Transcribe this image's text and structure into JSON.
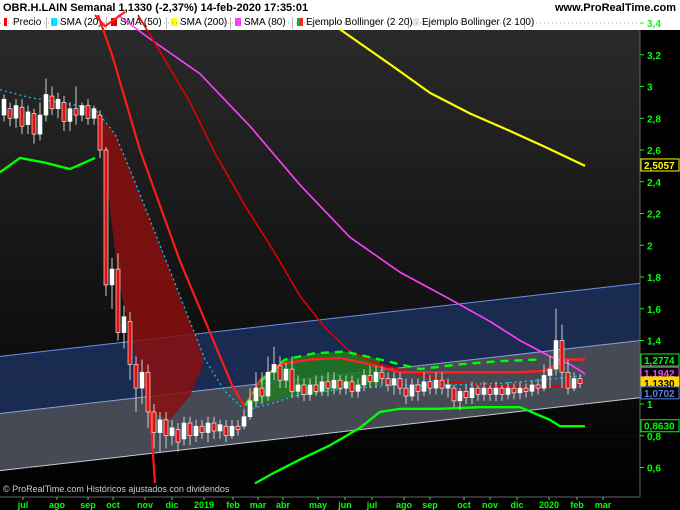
{
  "header": {
    "title": "OBR.H.LAIN Semanal 1,1330 (-2,37%) 14-feb-2020 17:35:01",
    "site": "www.ProRealTime.com"
  },
  "legend": [
    {
      "label": "Precio",
      "color": "#ff0000",
      "color2": "#ffffff"
    },
    {
      "label": "SMA (20)",
      "color": "#00e5ff"
    },
    {
      "label": "SMA (50)",
      "color": "#e00000"
    },
    {
      "label": "SMA (200)",
      "color": "#ffff00"
    },
    {
      "label": "SMA (80)",
      "color": "#ff40ff"
    },
    {
      "label": "Ejemplo Bollinger (2 20)",
      "color": "#00c000",
      "color2": "#ff2020"
    },
    {
      "label": "Ejemplo Bollinger (2 100)",
      "color": "#dde6f0"
    }
  ],
  "footer": {
    "copyright": "© ProRealTime.com  Históricos ajustados con dividendos"
  },
  "chart_data": {
    "type": "candlestick",
    "y_ticks": [
      "3,4",
      "3,2",
      "3",
      "2,8",
      "2,6",
      "2,4",
      "2,2",
      "2",
      "1,8",
      "1,6",
      "1,4",
      "1,2",
      "1",
      "0,8",
      "0,6"
    ],
    "x_ticks": [
      "jul",
      "ago",
      "sep",
      "oct",
      "nov",
      "dic",
      "2019",
      "feb",
      "mar",
      "abr",
      "may",
      "jun",
      "jul",
      "ago",
      "sep",
      "oct",
      "nov",
      "dic",
      "2020",
      "feb",
      "mar"
    ],
    "ylim": [
      0.5,
      3.45
    ],
    "price_tags": [
      {
        "label": "2,5057",
        "value": 2.5057,
        "color": "#ffff00"
      },
      {
        "label": "1,2774",
        "value": 1.2774,
        "color": "#00ff00"
      },
      {
        "label": "1,1942",
        "value": 1.1942,
        "color": "#ff40ff"
      },
      {
        "label": "1,1330",
        "value": 1.133,
        "color": "#ffd700"
      },
      {
        "label": "1,0702",
        "value": 1.0702,
        "color": "#5a7fe0"
      },
      {
        "label": "0,8630",
        "value": 0.863,
        "color": "#00ff00"
      }
    ],
    "series": [
      {
        "name": "SMA (200)",
        "points": [
          [
            340,
            3.36
          ],
          [
            390,
            3.14
          ],
          [
            430,
            2.96
          ],
          [
            470,
            2.83
          ],
          [
            510,
            2.72
          ],
          [
            545,
            2.62
          ],
          [
            585,
            2.5
          ]
        ]
      },
      {
        "name": "SMA (80)",
        "points": [
          [
            118,
            3.45
          ],
          [
            150,
            3.3
          ],
          [
            200,
            3.08
          ],
          [
            250,
            2.75
          ],
          [
            300,
            2.38
          ],
          [
            350,
            2.05
          ],
          [
            400,
            1.83
          ],
          [
            450,
            1.66
          ],
          [
            490,
            1.52
          ],
          [
            520,
            1.4
          ],
          [
            550,
            1.3
          ],
          [
            570,
            1.25
          ],
          [
            585,
            1.19
          ]
        ]
      },
      {
        "name": "SMA (50)",
        "points": [
          [
            138,
            3.45
          ],
          [
            160,
            3.22
          ],
          [
            190,
            2.9
          ],
          [
            215,
            2.58
          ],
          [
            245,
            2.25
          ],
          [
            275,
            1.95
          ],
          [
            300,
            1.68
          ],
          [
            325,
            1.48
          ],
          [
            350,
            1.33
          ],
          [
            380,
            1.25
          ],
          [
            410,
            1.2
          ],
          [
            450,
            1.14
          ],
          [
            500,
            1.11
          ],
          [
            540,
            1.1
          ],
          [
            575,
            1.12
          ],
          [
            585,
            1.15
          ]
        ]
      },
      {
        "name": "SMA (20)",
        "points": [
          [
            0,
            2.98
          ],
          [
            30,
            2.93
          ],
          [
            60,
            2.9
          ],
          [
            95,
            2.86
          ],
          [
            115,
            2.7
          ],
          [
            135,
            2.4
          ],
          [
            160,
            2.0
          ],
          [
            185,
            1.6
          ],
          [
            205,
            1.28
          ],
          [
            225,
            1.08
          ],
          [
            245,
            0.96
          ],
          [
            270,
            1.0
          ],
          [
            300,
            1.06
          ],
          [
            350,
            1.1
          ],
          [
            400,
            1.12
          ],
          [
            450,
            1.12
          ],
          [
            500,
            1.13
          ],
          [
            540,
            1.15
          ],
          [
            585,
            1.18
          ]
        ]
      },
      {
        "name": "Ejemplo Bollinger (2 20) upper",
        "points": [
          [
            95,
            3.45
          ],
          [
            105,
            3.38
          ],
          [
            125,
            3.47
          ]
        ]
      },
      {
        "name": "Ejemplo Bollinger (2 20) lower",
        "points": [
          [
            0,
            2.46
          ],
          [
            20,
            2.55
          ],
          [
            45,
            2.52
          ],
          [
            70,
            2.48
          ],
          [
            95,
            2.55
          ]
        ]
      },
      {
        "name": "Ejemplo Bollinger (2 20) basis",
        "points": [
          [
            245,
            0.99
          ],
          [
            260,
            1.15
          ],
          [
            280,
            1.25
          ],
          [
            310,
            1.28
          ],
          [
            340,
            1.29
          ],
          [
            370,
            1.25
          ],
          [
            400,
            1.2
          ],
          [
            440,
            1.2
          ],
          [
            480,
            1.2
          ],
          [
            520,
            1.2
          ],
          [
            545,
            1.21
          ],
          [
            565,
            1.28
          ],
          [
            585,
            1.28
          ]
        ]
      },
      {
        "name": "Ejemplo Bollinger (2 20) upper green",
        "points": [
          [
            245,
            0.99
          ],
          [
            262,
            1.15
          ],
          [
            285,
            1.28
          ],
          [
            315,
            1.32
          ],
          [
            345,
            1.33
          ],
          [
            380,
            1.28
          ],
          [
            420,
            1.22
          ],
          [
            460,
            1.25
          ],
          [
            500,
            1.27
          ],
          [
            540,
            1.28
          ]
        ]
      },
      {
        "name": "Ejemplo Bollinger (2 20) lower green",
        "points": [
          [
            255,
            0.5
          ],
          [
            275,
            0.57
          ],
          [
            300,
            0.65
          ],
          [
            330,
            0.74
          ],
          [
            360,
            0.85
          ],
          [
            380,
            0.95
          ],
          [
            400,
            0.97
          ],
          [
            440,
            0.97
          ],
          [
            480,
            0.98
          ],
          [
            520,
            0.98
          ],
          [
            550,
            0.9
          ],
          [
            560,
            0.86
          ],
          [
            585,
            0.86
          ]
        ]
      }
    ],
    "bollinger_100": {
      "upper": [
        [
          0,
          1.3
        ],
        [
          640,
          1.76
        ]
      ],
      "lower": [
        [
          0,
          0.58
        ],
        [
          640,
          1.04
        ]
      ],
      "mid": [
        [
          0,
          0.94
        ],
        [
          640,
          1.4
        ]
      ]
    },
    "candles": [
      [
        4,
        2.82,
        2.92,
        2.78,
        2.95
      ],
      [
        10,
        2.86,
        2.8,
        2.75,
        2.9
      ],
      [
        16,
        2.8,
        2.88,
        2.74,
        2.92
      ],
      [
        22,
        2.87,
        2.75,
        2.7,
        2.92
      ],
      [
        28,
        2.76,
        2.84,
        2.7,
        2.88
      ],
      [
        34,
        2.83,
        2.7,
        2.64,
        2.86
      ],
      [
        40,
        2.7,
        2.82,
        2.66,
        2.9
      ],
      [
        46,
        2.82,
        2.95,
        2.78,
        3.05
      ],
      [
        52,
        2.94,
        2.86,
        2.82,
        3.0
      ],
      [
        58,
        2.86,
        2.92,
        2.8,
        2.96
      ],
      [
        64,
        2.9,
        2.78,
        2.72,
        2.94
      ],
      [
        70,
        2.78,
        2.86,
        2.72,
        2.9
      ],
      [
        76,
        2.86,
        2.82,
        2.76,
        3.0
      ],
      [
        82,
        2.82,
        2.88,
        2.78,
        2.9
      ],
      [
        88,
        2.88,
        2.8,
        2.76,
        2.92
      ],
      [
        94,
        2.8,
        2.86,
        2.76,
        2.88
      ],
      [
        100,
        2.82,
        2.6,
        2.55,
        2.85
      ],
      [
        106,
        2.6,
        1.75,
        1.68,
        2.62
      ],
      [
        112,
        1.75,
        1.85,
        1.6,
        1.92
      ],
      [
        118,
        1.85,
        1.45,
        1.4,
        1.95
      ],
      [
        124,
        1.45,
        1.55,
        1.35,
        1.62
      ],
      [
        130,
        1.52,
        1.25,
        1.15,
        1.58
      ],
      [
        136,
        1.25,
        1.1,
        0.95,
        1.3
      ],
      [
        142,
        1.1,
        1.2,
        1.0,
        1.28
      ],
      [
        148,
        1.2,
        0.95,
        0.85,
        1.25
      ],
      [
        154,
        0.95,
        0.82,
        0.72,
        1.0
      ],
      [
        160,
        0.82,
        0.9,
        0.7,
        0.95
      ],
      [
        166,
        0.9,
        0.8,
        0.72,
        0.95
      ],
      [
        172,
        0.8,
        0.85,
        0.74,
        0.9
      ],
      [
        178,
        0.84,
        0.76,
        0.7,
        0.88
      ],
      [
        184,
        0.78,
        0.88,
        0.74,
        0.92
      ],
      [
        190,
        0.88,
        0.8,
        0.74,
        0.92
      ],
      [
        196,
        0.8,
        0.86,
        0.76,
        0.9
      ],
      [
        202,
        0.86,
        0.82,
        0.78,
        0.9
      ],
      [
        208,
        0.82,
        0.88,
        0.76,
        0.92
      ],
      [
        214,
        0.88,
        0.83,
        0.78,
        0.92
      ],
      [
        220,
        0.83,
        0.87,
        0.78,
        0.9
      ],
      [
        226,
        0.86,
        0.8,
        0.76,
        0.9
      ],
      [
        232,
        0.8,
        0.86,
        0.78,
        0.9
      ],
      [
        238,
        0.86,
        0.84,
        0.8,
        0.9
      ],
      [
        244,
        0.86,
        0.92,
        0.84,
        0.96
      ],
      [
        250,
        0.92,
        1.02,
        0.9,
        1.1
      ],
      [
        256,
        1.02,
        1.1,
        0.98,
        1.2
      ],
      [
        262,
        1.1,
        1.05,
        1.0,
        1.2
      ],
      [
        268,
        1.05,
        1.2,
        1.02,
        1.3
      ],
      [
        274,
        1.2,
        1.25,
        1.15,
        1.36
      ],
      [
        280,
        1.24,
        1.15,
        1.1,
        1.3
      ],
      [
        286,
        1.15,
        1.22,
        1.1,
        1.26
      ],
      [
        292,
        1.22,
        1.08,
        1.04,
        1.3
      ],
      [
        298,
        1.08,
        1.12,
        1.04,
        1.18
      ],
      [
        304,
        1.12,
        1.06,
        1.02,
        1.16
      ],
      [
        310,
        1.06,
        1.12,
        1.02,
        1.16
      ],
      [
        316,
        1.12,
        1.08,
        1.05,
        1.18
      ],
      [
        322,
        1.08,
        1.14,
        1.05,
        1.18
      ],
      [
        328,
        1.14,
        1.1,
        1.05,
        1.2
      ],
      [
        334,
        1.1,
        1.15,
        1.06,
        1.2
      ],
      [
        340,
        1.15,
        1.1,
        1.06,
        1.18
      ],
      [
        346,
        1.1,
        1.14,
        1.06,
        1.18
      ],
      [
        352,
        1.14,
        1.08,
        1.04,
        1.18
      ],
      [
        358,
        1.08,
        1.12,
        1.04,
        1.16
      ],
      [
        364,
        1.12,
        1.18,
        1.08,
        1.22
      ],
      [
        370,
        1.18,
        1.14,
        1.1,
        1.24
      ],
      [
        376,
        1.14,
        1.2,
        1.1,
        1.24
      ],
      [
        382,
        1.2,
        1.16,
        1.12,
        1.24
      ],
      [
        388,
        1.16,
        1.12,
        1.08,
        1.2
      ],
      [
        394,
        1.12,
        1.16,
        1.06,
        1.2
      ],
      [
        400,
        1.16,
        1.1,
        1.06,
        1.2
      ],
      [
        406,
        1.1,
        1.05,
        1.0,
        1.16
      ],
      [
        412,
        1.05,
        1.12,
        1.02,
        1.16
      ],
      [
        418,
        1.12,
        1.08,
        1.02,
        1.16
      ],
      [
        424,
        1.08,
        1.14,
        1.05,
        1.2
      ],
      [
        430,
        1.14,
        1.1,
        1.06,
        1.18
      ],
      [
        436,
        1.1,
        1.15,
        1.06,
        1.2
      ],
      [
        442,
        1.15,
        1.1,
        1.06,
        1.2
      ],
      [
        448,
        1.1,
        1.12,
        1.04,
        1.16
      ],
      [
        454,
        1.1,
        1.02,
        0.98,
        1.12
      ],
      [
        460,
        1.02,
        1.08,
        0.96,
        1.1
      ],
      [
        466,
        1.08,
        1.04,
        1.0,
        1.12
      ],
      [
        472,
        1.04,
        1.1,
        1.0,
        1.14
      ],
      [
        478,
        1.1,
        1.06,
        1.02,
        1.12
      ],
      [
        484,
        1.06,
        1.1,
        1.02,
        1.14
      ],
      [
        490,
        1.1,
        1.06,
        1.02,
        1.12
      ],
      [
        496,
        1.06,
        1.1,
        1.02,
        1.14
      ],
      [
        502,
        1.1,
        1.06,
        1.02,
        1.12
      ],
      [
        508,
        1.06,
        1.1,
        1.03,
        1.14
      ],
      [
        514,
        1.1,
        1.07,
        1.03,
        1.13
      ],
      [
        520,
        1.07,
        1.1,
        1.03,
        1.14
      ],
      [
        526,
        1.1,
        1.08,
        1.04,
        1.13
      ],
      [
        532,
        1.08,
        1.12,
        1.05,
        1.15
      ],
      [
        538,
        1.12,
        1.1,
        1.06,
        1.16
      ],
      [
        544,
        1.1,
        1.18,
        1.08,
        1.25
      ],
      [
        550,
        1.18,
        1.22,
        1.1,
        1.3
      ],
      [
        556,
        1.22,
        1.4,
        1.18,
        1.6
      ],
      [
        562,
        1.4,
        1.2,
        1.1,
        1.5
      ],
      [
        568,
        1.2,
        1.1,
        1.06,
        1.28
      ],
      [
        574,
        1.1,
        1.16,
        1.08,
        1.2
      ],
      [
        580,
        1.16,
        1.13,
        1.1,
        1.19
      ]
    ]
  }
}
